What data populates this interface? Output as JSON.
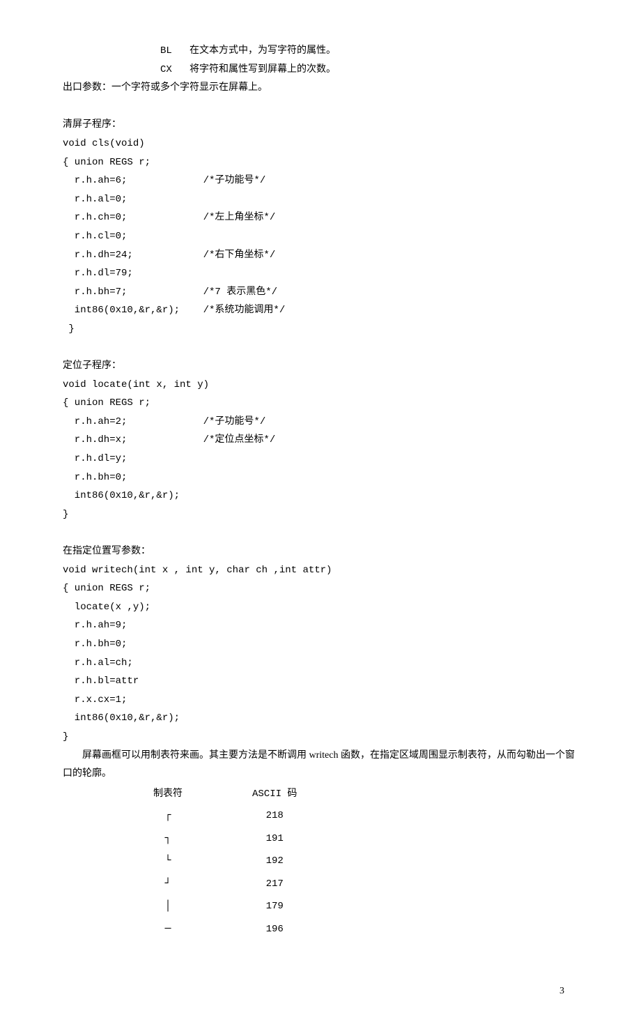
{
  "header": {
    "bl": "BL   在文本方式中，为写字符的属性。",
    "cx": "CX   将字符和属性写到屏幕上的次数。"
  },
  "exit_param": "出口参数：一个字符或多个字符显示在屏幕上。",
  "cls": {
    "title": "清屏子程序：",
    "l1": "void cls(void)",
    "l2": "{ union REGS r;",
    "l3": "  r.h.ah=6;             /*子功能号*/",
    "l4": "  r.h.al=0;",
    "l5": "  r.h.ch=0;             /*左上角坐标*/",
    "l6": "  r.h.cl=0;",
    "l7": "  r.h.dh=24;            /*右下角坐标*/",
    "l8": "  r.h.dl=79;",
    "l9": "  r.h.bh=7;             /*7 表示黑色*/",
    "l10": "  int86(0x10,&r,&r);    /*系统功能调用*/",
    "l11": " }"
  },
  "locate": {
    "title": "定位子程序：",
    "l1": "void locate(int x, int y)",
    "l2": "{ union REGS r;",
    "l3": "  r.h.ah=2;             /*子功能号*/",
    "l4": "  r.h.dh=x;             /*定位点坐标*/",
    "l5": "  r.h.dl=y;",
    "l6": "  r.h.bh=0;",
    "l7": "  int86(0x10,&r,&r);",
    "l8": "}"
  },
  "writech": {
    "title": "在指定位置写参数：",
    "l1": "void writech(int x , int y, char ch ,int attr)",
    "l2": "{ union REGS r;",
    "l3": "  locate(x ,y);",
    "l4": "  r.h.ah=9;",
    "l5": "  r.h.bh=0;",
    "l6": "  r.h.al=ch;",
    "l7": "  r.h.bl=attr",
    "l8": "  r.x.cx=1;",
    "l9": "  int86(0x10,&r,&r);",
    "l10": "}"
  },
  "frame": {
    "p1": "屏幕画框可以用制表符来画。其主要方法是不断调用 writech 函数，在指定区域周围显示制表符，从而勾勒出一个窗口的轮廓。"
  },
  "table": {
    "h1": "制表符",
    "h2": "ASCII 码",
    "rows": [
      {
        "sym": "┌",
        "code": "218"
      },
      {
        "sym": "┐",
        "code": "191"
      },
      {
        "sym": "└",
        "code": "192"
      },
      {
        "sym": "┘",
        "code": "217"
      },
      {
        "sym": "│",
        "code": "179"
      },
      {
        "sym": "─",
        "code": "196"
      }
    ]
  },
  "page": "3"
}
